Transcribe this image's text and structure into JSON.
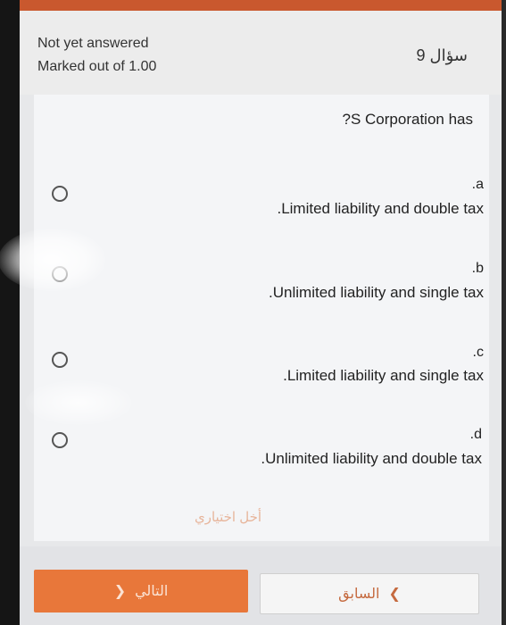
{
  "header": {
    "status": "Not yet answered",
    "marks": "Marked out of 1.00",
    "question_number": "سؤال 9"
  },
  "question": {
    "text": "?S Corporation has",
    "options": [
      {
        "letter": ".a",
        "text": ".Limited liability and double tax",
        "selected": false
      },
      {
        "letter": ".b",
        "text": ".Unlimited liability and single tax",
        "selected": false
      },
      {
        "letter": ".c",
        "text": ".Limited liability and single tax",
        "selected": false
      },
      {
        "letter": ".d",
        "text": ".Unlimited liability and double tax",
        "selected": false
      }
    ],
    "clear_choice": "أخل اختياري"
  },
  "navigation": {
    "next_label": "التالي",
    "prev_label": "السابق"
  },
  "colors": {
    "accent": "#e8773a",
    "top_bar": "#c9582e"
  }
}
